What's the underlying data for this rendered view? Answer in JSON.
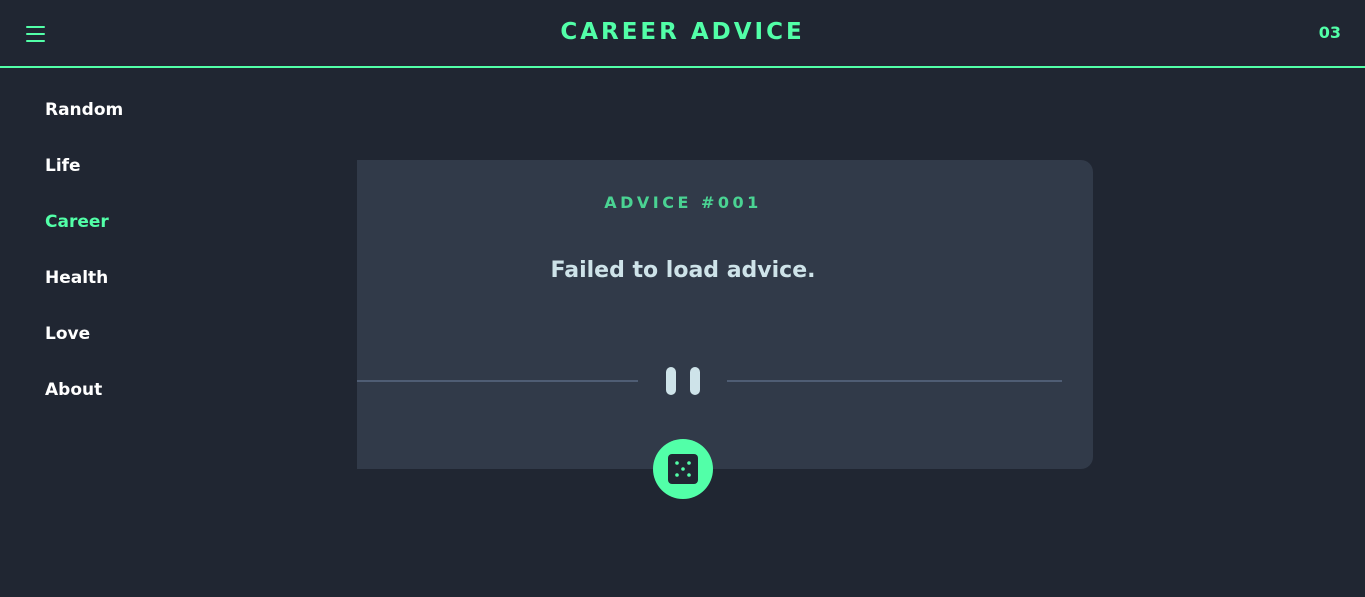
{
  "header": {
    "menu_icon": "hamburger-menu-icon",
    "title": "CAREER ADVICE",
    "counter": "03"
  },
  "sidebar": {
    "items": [
      {
        "label": "Random",
        "active": false
      },
      {
        "label": "Life",
        "active": false
      },
      {
        "label": "Career",
        "active": true
      },
      {
        "label": "Health",
        "active": false
      },
      {
        "label": "Love",
        "active": false
      },
      {
        "label": "About",
        "active": false
      }
    ]
  },
  "card": {
    "advice_id": "ADVICE #001",
    "advice_text": "Failed to load advice.",
    "divider_icon": "pause-icon",
    "dice_icon": "dice-icon"
  },
  "colors": {
    "background": "#202632",
    "card": "#313a49",
    "accent": "#52ffa8",
    "text_light": "#cee3e9",
    "divider": "#4f5d74"
  }
}
